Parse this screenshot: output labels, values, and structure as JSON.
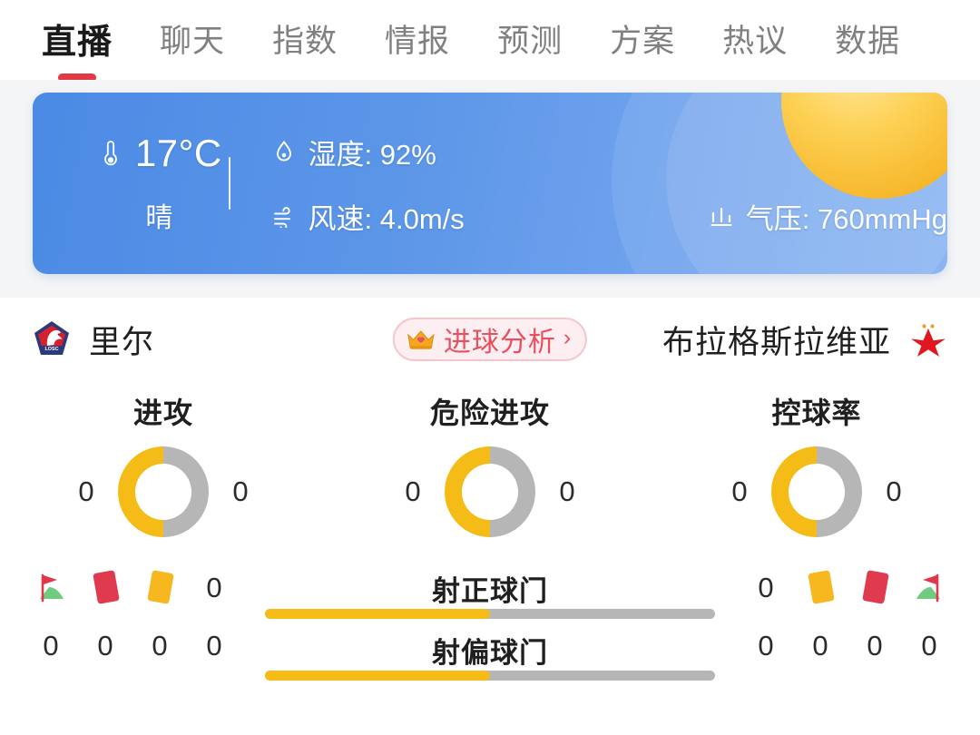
{
  "tabs": [
    {
      "label": "直播",
      "active": true
    },
    {
      "label": "聊天",
      "active": false
    },
    {
      "label": "指数",
      "active": false
    },
    {
      "label": "情报",
      "active": false
    },
    {
      "label": "预测",
      "active": false
    },
    {
      "label": "方案",
      "active": false
    },
    {
      "label": "热议",
      "active": false
    },
    {
      "label": "数据",
      "active": false
    }
  ],
  "weather": {
    "temperature": "17°C",
    "condition": "晴",
    "humidity_label": "湿度: 92%",
    "wind_label": "风速: 4.0m/s",
    "pressure_label": "气压: 760mmHg",
    "icons": {
      "temperature": "thermometer-icon",
      "humidity": "water-drop-icon",
      "wind": "wind-icon",
      "pressure": "pressure-icon",
      "sun": "sun-icon"
    },
    "colors": {
      "card_left": "#4B8AE5",
      "card_right": "#81AFF1",
      "sun": "#FDD257"
    }
  },
  "match": {
    "home_team": "里尔",
    "away_team": "布拉格斯拉维亚",
    "home_crest": "losc-lille-crest",
    "away_crest": "slavia-prague-star-crest",
    "goal_analysis": {
      "label": "进球分析",
      "icon": "crown-icon",
      "chevron": "›",
      "accent": "#E8505F"
    }
  },
  "donut_stats": [
    {
      "title": "进攻",
      "home": "0",
      "away": "0",
      "home_pct": 50
    },
    {
      "title": "危险进攻",
      "home": "0",
      "away": "0",
      "home_pct": 50
    },
    {
      "title": "控球率",
      "home": "0",
      "away": "0",
      "home_pct": 50
    }
  ],
  "bar_stats": [
    {
      "label": "射正球门",
      "home": "0",
      "away": "0",
      "home_pct": 50
    },
    {
      "label": "射偏球门",
      "home": "0",
      "away": "0",
      "home_pct": 50
    }
  ],
  "event_icons": {
    "home": [
      {
        "name": "corner-flag-icon",
        "value": "0"
      },
      {
        "name": "red-card-icon",
        "value": "0"
      },
      {
        "name": "yellow-card-icon",
        "value": "0"
      }
    ],
    "away": [
      {
        "name": "yellow-card-icon",
        "value": "0"
      },
      {
        "name": "red-card-icon",
        "value": "0"
      },
      {
        "name": "corner-flag-icon",
        "value": "0"
      }
    ]
  },
  "colors": {
    "accent_yellow": "#F5BC18",
    "track_gray": "#B6B6B6",
    "tab_active_underline": "#E03A45",
    "page_bg": "#FFFFFF",
    "band_bg": "#F4F5F7"
  },
  "chart_data": [
    {
      "type": "pie",
      "title": "进攻",
      "categories": [
        "里尔",
        "布拉格斯拉维亚"
      ],
      "values": [
        0,
        0
      ],
      "display_values": [
        "0",
        "0"
      ],
      "split_pct": [
        50,
        50
      ]
    },
    {
      "type": "pie",
      "title": "危险进攻",
      "categories": [
        "里尔",
        "布拉格斯拉维亚"
      ],
      "values": [
        0,
        0
      ],
      "display_values": [
        "0",
        "0"
      ],
      "split_pct": [
        50,
        50
      ]
    },
    {
      "type": "pie",
      "title": "控球率",
      "categories": [
        "里尔",
        "布拉格斯拉维亚"
      ],
      "values": [
        0,
        0
      ],
      "display_values": [
        "0",
        "0"
      ],
      "split_pct": [
        50,
        50
      ]
    },
    {
      "type": "bar",
      "title": "射正球门",
      "categories": [
        "里尔",
        "布拉格斯拉维亚"
      ],
      "values": [
        0,
        0
      ],
      "split_pct": [
        50,
        50
      ]
    },
    {
      "type": "bar",
      "title": "射偏球门",
      "categories": [
        "里尔",
        "布拉格斯拉维亚"
      ],
      "values": [
        0,
        0
      ],
      "split_pct": [
        50,
        50
      ]
    }
  ]
}
